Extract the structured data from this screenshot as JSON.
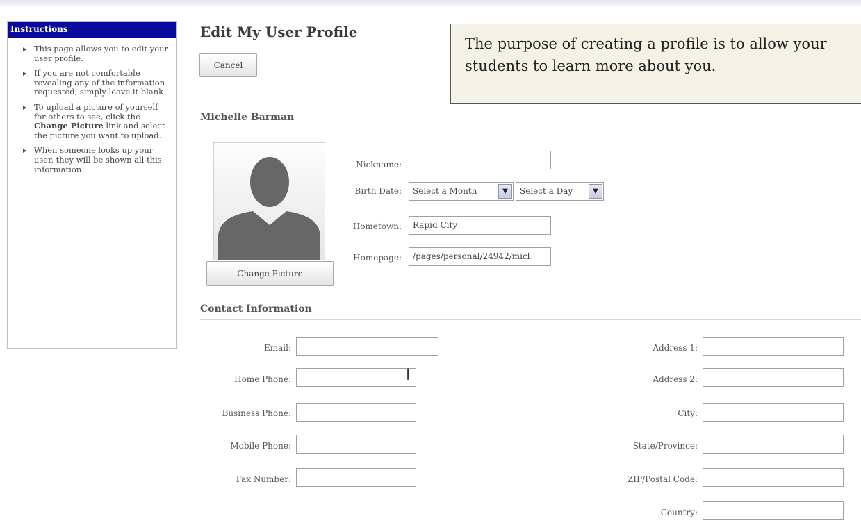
{
  "sidebar": {
    "title": "Instructions",
    "items": [
      {
        "text": "This page allows you to edit your user profile."
      },
      {
        "text": "If you are not comfortable revealing any of the information requested, simply leave it blank."
      },
      {
        "text_before": "To upload a picture of yourself for others to see, click the ",
        "bold": "Change Picture",
        "text_after": " link and select the picture you want to upload."
      },
      {
        "text": "When someone looks up your user, they will be shown all this information."
      }
    ]
  },
  "page": {
    "title": "Edit My User Profile",
    "cancel_label": "Cancel",
    "callout": "The purpose of creating a profile is to allow your students to learn more about you."
  },
  "profile": {
    "name": "Michelle Barman",
    "avatar_icon": "person-silhouette-icon",
    "change_picture_label": "Change Picture",
    "nickname_label": "Nickname:",
    "nickname_value": "",
    "birthdate_label": "Birth Date:",
    "birth_month": "Select a Month",
    "birth_day": "Select a Day",
    "hometown_label": "Hometown:",
    "hometown_value": "Rapid City",
    "homepage_label": "Homepage:",
    "homepage_value": "/pages/personal/24942/micl"
  },
  "contact": {
    "heading": "Contact Information",
    "left": [
      {
        "label": "Email:",
        "value": ""
      },
      {
        "label": "Home Phone:",
        "value": ""
      },
      {
        "label": "Business Phone:",
        "value": ""
      },
      {
        "label": "Mobile Phone:",
        "value": ""
      },
      {
        "label": "Fax Number:",
        "value": ""
      }
    ],
    "right": [
      {
        "label": "Address 1:",
        "value": ""
      },
      {
        "label": "Address 2:",
        "value": ""
      },
      {
        "label": "City:",
        "value": ""
      },
      {
        "label": "State/Province:",
        "value": ""
      },
      {
        "label": "ZIP/Postal Code:",
        "value": ""
      },
      {
        "label": "Country:",
        "value": ""
      }
    ]
  },
  "colors": {
    "instructions_header": "#0a0a9e",
    "callout_bg": "#f4f1e6"
  }
}
